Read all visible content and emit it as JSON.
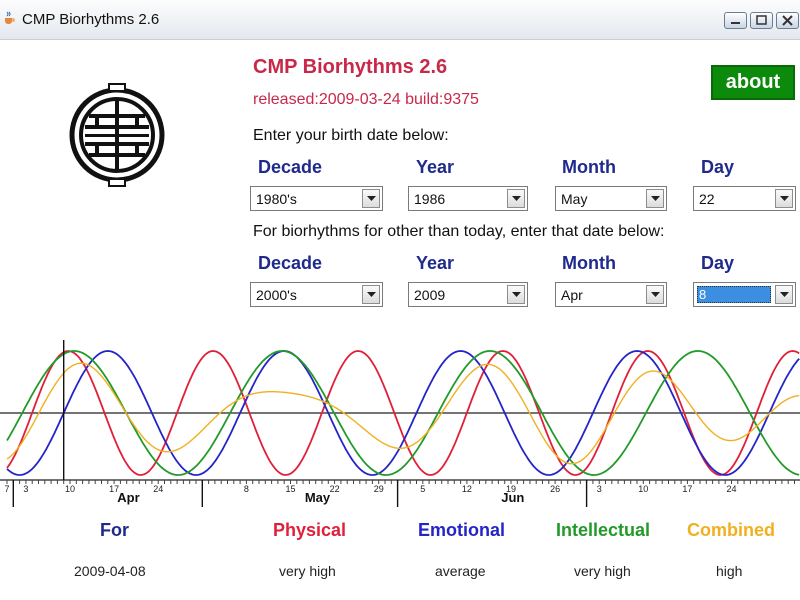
{
  "window": {
    "title": "CMP Biorhythms 2.6"
  },
  "header": {
    "app_title": "CMP Biorhythms 2.6",
    "release": "released:2009-03-24 build:9375",
    "about_label": "about"
  },
  "birth": {
    "prompt": "Enter your birth date below:",
    "labels": {
      "decade": "Decade",
      "year": "Year",
      "month": "Month",
      "day": "Day"
    },
    "decade": "1980's",
    "year": "1986",
    "month": "May",
    "day": "22"
  },
  "target": {
    "prompt": "For biorhythms for other than today, enter that date below:",
    "labels": {
      "decade": "Decade",
      "year": "Year",
      "month": "Month",
      "day": "Day"
    },
    "decade": "2000's",
    "year": "2009",
    "month": "Apr",
    "day": "8"
  },
  "chart_data": {
    "type": "line",
    "axis_ticks": [
      {
        "day": 0,
        "label": "7"
      },
      {
        "day": 3,
        "label": "3"
      },
      {
        "day": 10,
        "label": "10"
      },
      {
        "day": 17,
        "label": "17"
      },
      {
        "day": 24,
        "label": "24"
      },
      {
        "day": 38,
        "label": "8"
      },
      {
        "day": 45,
        "label": "15"
      },
      {
        "day": 52,
        "label": "22"
      },
      {
        "day": 59,
        "label": "29"
      },
      {
        "day": 66,
        "label": "5"
      },
      {
        "day": 73,
        "label": "12"
      },
      {
        "day": 80,
        "label": "19"
      },
      {
        "day": 87,
        "label": "26"
      },
      {
        "day": 94,
        "label": "3"
      },
      {
        "day": 101,
        "label": "10"
      },
      {
        "day": 108,
        "label": "17"
      },
      {
        "day": 115,
        "label": "24"
      }
    ],
    "months": [
      {
        "day": 5,
        "label": "Apr"
      },
      {
        "day": 35,
        "label": "May"
      },
      {
        "day": 66,
        "label": "Jun"
      }
    ],
    "month_boundaries": [
      1,
      31,
      62,
      92
    ],
    "selected_day": 9,
    "series": [
      {
        "name": "Physical",
        "color": "#e0203a",
        "period": 23,
        "value_at_selected": 0.98
      },
      {
        "name": "Emotional",
        "color": "#2424c8",
        "period": 28,
        "value_at_selected": 0.0
      },
      {
        "name": "Intellectual",
        "color": "#229a2a",
        "period": 33,
        "value_at_selected": 0.95
      },
      {
        "name": "Combined",
        "color": "#f0b020"
      }
    ]
  },
  "summary": {
    "for_label": "For",
    "for_value": "2009-04-08",
    "physical_label": "Physical",
    "physical_value": "very high",
    "emotional_label": "Emotional",
    "emotional_value": "average",
    "intellectual_label": "Intellectual",
    "intellectual_value": "very high",
    "combined_label": "Combined",
    "combined_value": "high"
  }
}
